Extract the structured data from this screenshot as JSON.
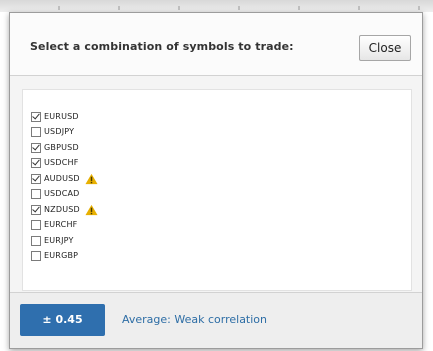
{
  "dialog": {
    "prompt": "Select a combination of symbols to trade:",
    "close_label": "Close"
  },
  "symbols": [
    {
      "label": "EURUSD",
      "checked": true,
      "warning": false
    },
    {
      "label": "USDJPY",
      "checked": false,
      "warning": false
    },
    {
      "label": "GBPUSD",
      "checked": true,
      "warning": false
    },
    {
      "label": "USDCHF",
      "checked": true,
      "warning": false
    },
    {
      "label": "AUDUSD",
      "checked": true,
      "warning": true
    },
    {
      "label": "USDCAD",
      "checked": false,
      "warning": false
    },
    {
      "label": "NZDUSD",
      "checked": true,
      "warning": true
    },
    {
      "label": "EURCHF",
      "checked": false,
      "warning": false
    },
    {
      "label": "EURJPY",
      "checked": false,
      "warning": false
    },
    {
      "label": "EURGBP",
      "checked": false,
      "warning": false
    }
  ],
  "footer": {
    "value": "± 0.45",
    "description": "Average: Weak correlation",
    "badge_color": "#2f6fae"
  },
  "warning_icon": "warning-triangle-icon",
  "warning_color": "#e8b000"
}
